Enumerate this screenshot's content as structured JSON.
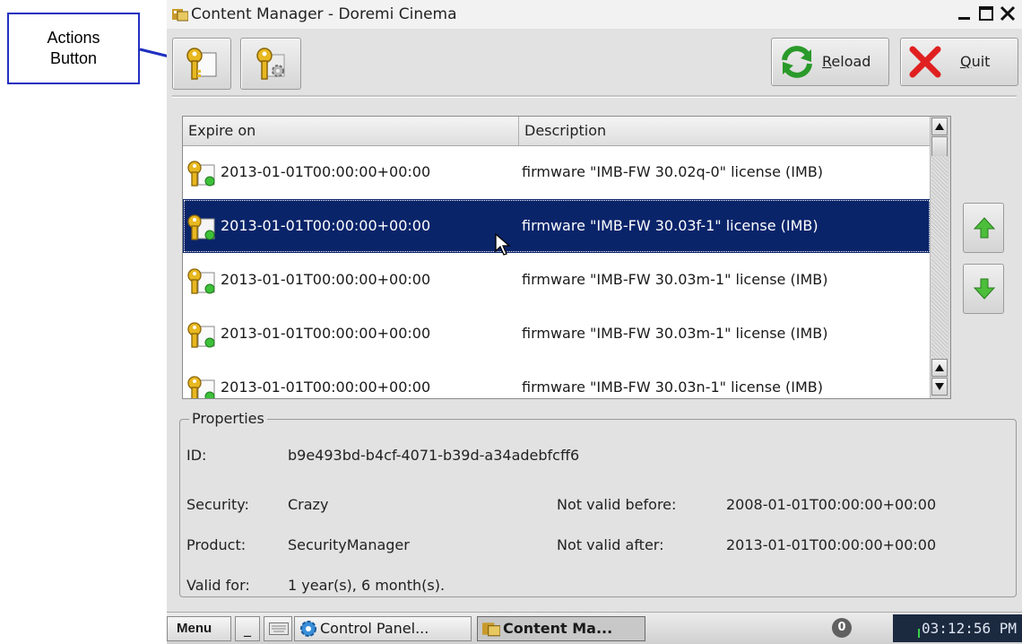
{
  "callout": {
    "line1": "Actions",
    "line2": "Button"
  },
  "window": {
    "title": "Content Manager - Doremi Cinema",
    "controls": [
      "minimize",
      "maximize",
      "close"
    ]
  },
  "toolbar": {
    "key_button_icon": "key-document-icon",
    "actions_button_icon": "key-gear-icon",
    "reload": {
      "prefix": "",
      "mnemonic": "R",
      "rest": "eload",
      "icon": "reload-icon"
    },
    "quit": {
      "prefix": "",
      "mnemonic": "Q",
      "rest": "uit",
      "icon": "red-x-icon"
    }
  },
  "list": {
    "columns": [
      "Expire on",
      "Description"
    ],
    "rows": [
      {
        "expire": "2013-01-01T00:00:00+00:00",
        "description": "firmware \"IMB-FW  30.02q-0\" license (IMB)",
        "selected": false
      },
      {
        "expire": "2013-01-01T00:00:00+00:00",
        "description": "firmware \"IMB-FW  30.03f-1\" license (IMB)",
        "selected": true
      },
      {
        "expire": "2013-01-01T00:00:00+00:00",
        "description": "firmware \"IMB-FW  30.03m-1\" license (IMB)",
        "selected": false
      },
      {
        "expire": "2013-01-01T00:00:00+00:00",
        "description": "firmware \"IMB-FW  30.03m-1\" license (IMB)",
        "selected": false
      },
      {
        "expire": "2013-01-01T00:00:00+00:00",
        "description": "firmware \"IMB-FW  30.03n-1\" license (IMB)",
        "selected": false
      }
    ]
  },
  "side_buttons": {
    "up_icon": "green-arrow-up-icon",
    "down_icon": "green-arrow-down-icon"
  },
  "properties": {
    "legend": "Properties",
    "id_label": "ID:",
    "id_value": "b9e493bd-b4cf-4071-b39d-a34adebfcff6",
    "security_label": "Security:",
    "security_value": "Crazy",
    "product_label": "Product:",
    "product_value": "SecurityManager",
    "valid_for_label": "Valid for:",
    "valid_for_value": "1 year(s), 6 month(s).",
    "not_before_label": "Not valid before:",
    "not_before_value": "2008-01-01T00:00:00+00:00",
    "not_after_label": "Not valid after:",
    "not_after_value": "2013-01-01T00:00:00+00:00"
  },
  "taskbar": {
    "menu": "Menu",
    "underscore": "_",
    "control_panel": "Control Panel...",
    "content_manager": "Content Ma...",
    "notification": "0",
    "clock": "03:12:56 PM"
  },
  "colors": {
    "selection": "#0a246a",
    "clock_bg": "#1c2a40",
    "callout_border": "#2030c0"
  }
}
